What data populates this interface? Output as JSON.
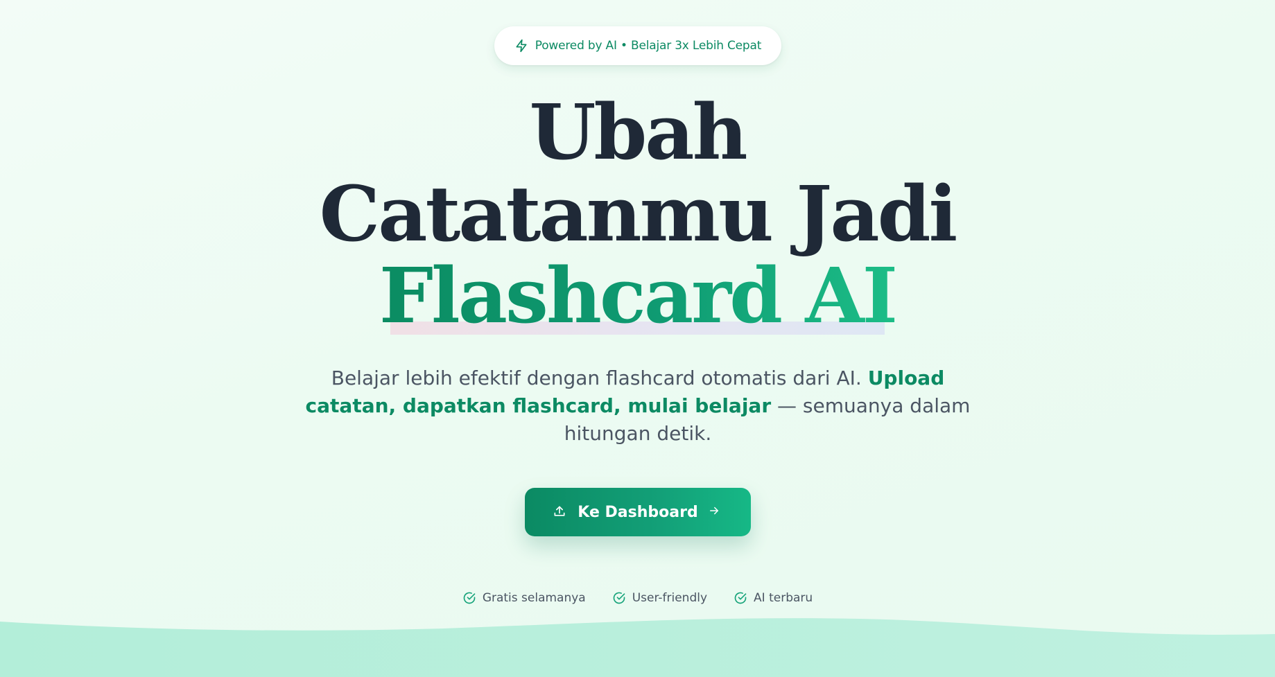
{
  "badge": {
    "text": "Powered by AI • Belajar 3x Lebih Cepat",
    "icon": "lightning-icon"
  },
  "headline": {
    "line1": "Ubah",
    "line2": "Catatanmu Jadi",
    "line3": "Flashcard AI"
  },
  "description": {
    "part1": "Belajar lebih efektif dengan flashcard otomatis dari AI. ",
    "highlight": "Upload catatan, dapatkan flashcard, mulai belajar",
    "part2": " — semuanya dalam hitungan detik."
  },
  "cta": {
    "label": "Ke Dashboard",
    "left_icon": "upload-icon",
    "right_icon": "arrow-right-icon"
  },
  "features": [
    {
      "label": "Gratis selamanya",
      "icon": "check-circle-icon"
    },
    {
      "label": "User-friendly",
      "icon": "check-circle-icon"
    },
    {
      "label": "AI terbaru",
      "icon": "check-circle-icon"
    }
  ],
  "colors": {
    "accent": "#0c8a63",
    "accent_light": "#16b886",
    "heading": "#1f2937",
    "body_text": "#4b5563",
    "wave": "#b6eedb"
  }
}
